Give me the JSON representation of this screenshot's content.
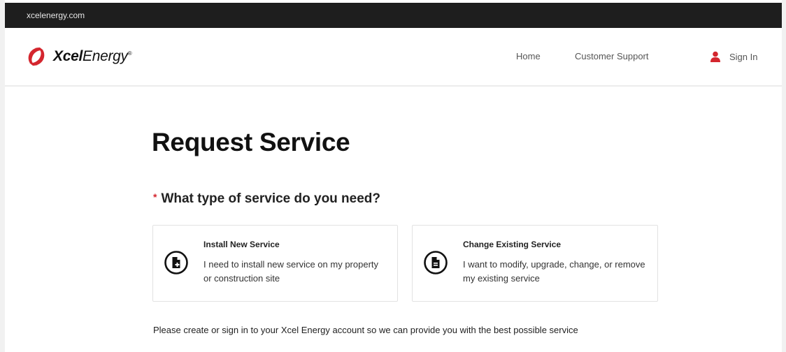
{
  "browser": {
    "url": "xcelenergy.com"
  },
  "header": {
    "logo": {
      "name": "Xcel",
      "name_light": "Energy",
      "mark": "®",
      "icon": "xcel-swoosh-logo"
    },
    "nav": {
      "home": "Home",
      "customer_support": "Customer Support",
      "sign_in": "Sign In",
      "sign_in_icon": "user-icon"
    }
  },
  "main": {
    "title": "Request Service",
    "question": {
      "required_marker": "*",
      "text": "What type of service do you need?"
    },
    "options": [
      {
        "title": "Install New Service",
        "description": "I need to install new service on my property or construction site",
        "icon": "install-document-icon"
      },
      {
        "title": "Change Existing Service",
        "description": "I want to modify, upgrade, change, or remove my existing service",
        "icon": "change-document-icon"
      }
    ],
    "footnote": "Please create or sign in to your Xcel Energy account so we can provide you with the best possible service"
  },
  "colors": {
    "brand_red": "#d4262e",
    "topbar": "#1e1e1e",
    "text": "#1a1a1a",
    "card_border": "#e2e2e2"
  }
}
